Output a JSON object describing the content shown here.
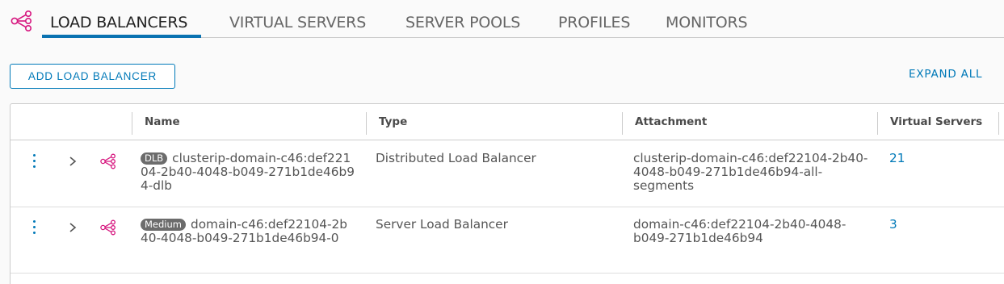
{
  "colors": {
    "accent": "#0079b8",
    "icon_pink": "#d6157e",
    "badge": "#6c6c6c"
  },
  "tabs": [
    {
      "label": "LOAD BALANCERS",
      "active": true
    },
    {
      "label": "VIRTUAL SERVERS"
    },
    {
      "label": "SERVER POOLS"
    },
    {
      "label": "PROFILES"
    },
    {
      "label": "MONITORS"
    }
  ],
  "tab_icon": "load-balancer-icon",
  "toolbar": {
    "add_label": "ADD LOAD BALANCER",
    "expand_label": "EXPAND ALL"
  },
  "grid": {
    "columns": [
      "Name",
      "Type",
      "Attachment",
      "Virtual Servers"
    ],
    "rows": [
      {
        "badge": "DLB",
        "name": "clusterip-domain-c46:def22104-2b40-4048-b049-271b1de46b94-dlb",
        "type": "Distributed Load Balancer",
        "attachment": "clusterip-domain-c46:def22104-2b40-4048-b049-271b1de46b94-all-segments",
        "virtual_servers": "21"
      },
      {
        "badge": "Medium",
        "name": "domain-c46:def22104-2b40-4048-b049-271b1de46b94-0",
        "type": "Server Load Balancer",
        "attachment": "domain-c46:def22104-2b40-4048-b049-271b1de46b94",
        "virtual_servers": "3"
      }
    ]
  }
}
